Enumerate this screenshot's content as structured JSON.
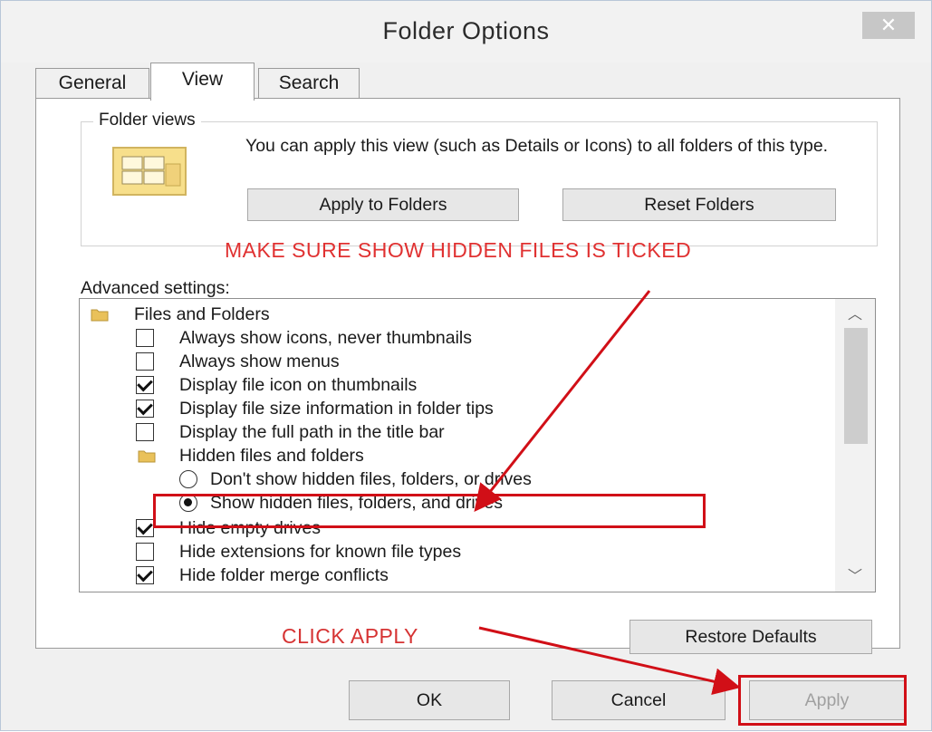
{
  "window": {
    "title": "Folder Options",
    "close_icon": "close-icon"
  },
  "tabs": [
    {
      "label": "General",
      "active": false
    },
    {
      "label": "View",
      "active": true
    },
    {
      "label": "Search",
      "active": false
    }
  ],
  "folder_views": {
    "title": "Folder views",
    "description": "You can apply this view (such as Details or Icons) to all folders of this type.",
    "icon": "folder-views-icon",
    "apply_label": "Apply to Folders",
    "reset_label": "Reset Folders"
  },
  "annotations": {
    "top_note": "MAKE SURE SHOW HIDDEN FILES IS TICKED",
    "bottom_note": "CLICK APPLY",
    "color": "#d10f17"
  },
  "advanced": {
    "label": "Advanced settings:",
    "items": [
      {
        "type": "folder",
        "label": "Files and Folders"
      },
      {
        "type": "checkbox",
        "checked": false,
        "label": "Always show icons, never thumbnails"
      },
      {
        "type": "checkbox",
        "checked": false,
        "label": "Always show menus"
      },
      {
        "type": "checkbox",
        "checked": true,
        "label": "Display file icon on thumbnails"
      },
      {
        "type": "checkbox",
        "checked": true,
        "label": "Display file size information in folder tips"
      },
      {
        "type": "checkbox",
        "checked": false,
        "label": "Display the full path in the title bar"
      },
      {
        "type": "folder",
        "label": "Hidden files and folders"
      },
      {
        "type": "radio",
        "selected": false,
        "label": "Don't show hidden files, folders, or drives"
      },
      {
        "type": "radio",
        "selected": true,
        "label": "Show hidden files, folders, and drives"
      },
      {
        "type": "checkbox",
        "checked": true,
        "label": "Hide empty drives"
      },
      {
        "type": "checkbox",
        "checked": false,
        "label": "Hide extensions for known file types"
      },
      {
        "type": "checkbox",
        "checked": true,
        "label": "Hide folder merge conflicts"
      }
    ]
  },
  "buttons": {
    "restore_defaults": "Restore Defaults",
    "ok": "OK",
    "cancel": "Cancel",
    "apply": "Apply"
  }
}
